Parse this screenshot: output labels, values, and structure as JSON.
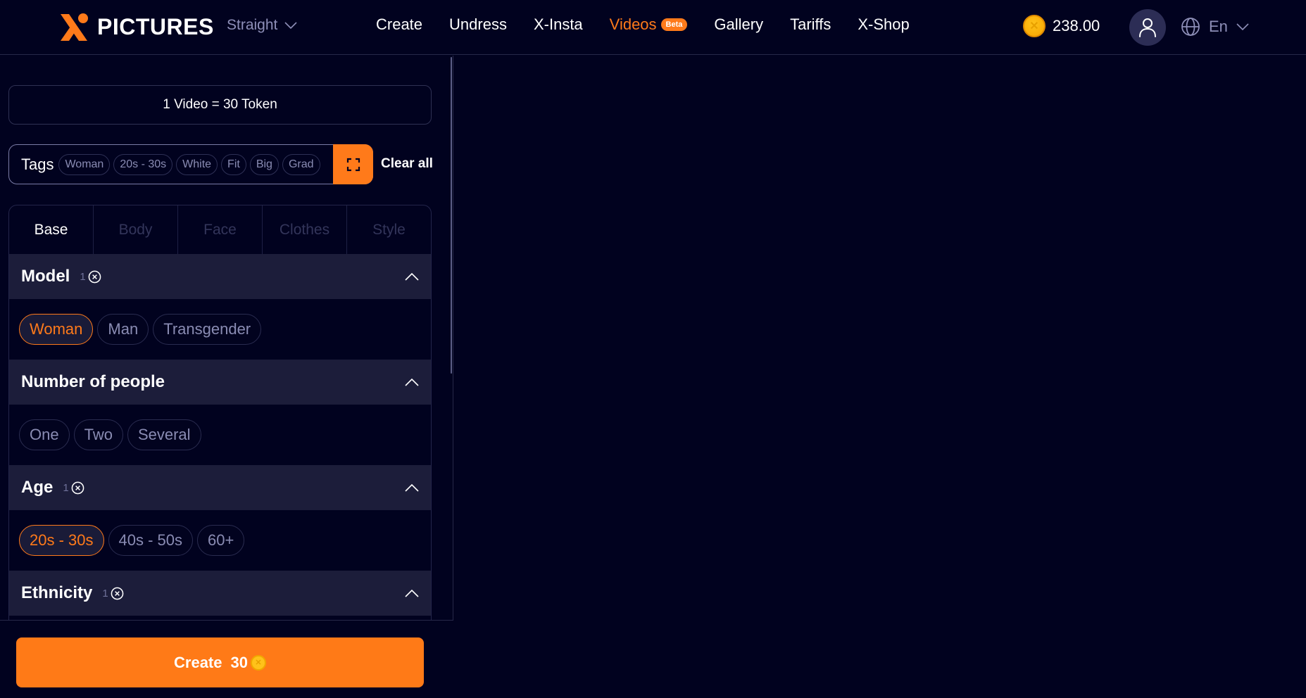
{
  "header": {
    "brand": "PICTURES",
    "orientation": "Straight",
    "nav": [
      {
        "label": "Create",
        "active": false
      },
      {
        "label": "Undress",
        "active": false
      },
      {
        "label": "X-Insta",
        "active": false
      },
      {
        "label": "Videos",
        "active": true,
        "badge": "Beta"
      },
      {
        "label": "Gallery",
        "active": false
      },
      {
        "label": "Tariffs",
        "active": false
      },
      {
        "label": "X-Shop",
        "active": false
      }
    ],
    "balance": "238.00",
    "language": "En"
  },
  "sidebar": {
    "token_info": "1 Video = 30 Token",
    "tags_label": "Tags",
    "tags": [
      "Woman",
      "20s - 30s",
      "White",
      "Fit",
      "Big",
      "Grad"
    ],
    "clear_all": "Clear all",
    "tabs": [
      {
        "label": "Base",
        "active": true
      },
      {
        "label": "Body",
        "active": false
      },
      {
        "label": "Face",
        "active": false
      },
      {
        "label": "Clothes",
        "active": false
      },
      {
        "label": "Style",
        "active": false
      }
    ],
    "sections": [
      {
        "title": "Model",
        "count": "1",
        "options": [
          {
            "label": "Woman",
            "selected": true
          },
          {
            "label": "Man",
            "selected": false
          },
          {
            "label": "Transgender",
            "selected": false
          }
        ]
      },
      {
        "title": "Number of people",
        "count": null,
        "options": [
          {
            "label": "One",
            "selected": false
          },
          {
            "label": "Two",
            "selected": false
          },
          {
            "label": "Several",
            "selected": false
          }
        ]
      },
      {
        "title": "Age",
        "count": "1",
        "options": [
          {
            "label": "20s - 30s",
            "selected": true
          },
          {
            "label": "40s - 50s",
            "selected": false
          },
          {
            "label": "60+",
            "selected": false
          }
        ]
      },
      {
        "title": "Ethnicity",
        "count": "1",
        "options": []
      }
    ],
    "create_button": {
      "label": "Create",
      "cost": "30"
    }
  },
  "colors": {
    "accent": "#ff7a1a",
    "background": "#01021f",
    "section_header": "#1c1d3a",
    "muted_text": "#8a8cb3"
  }
}
